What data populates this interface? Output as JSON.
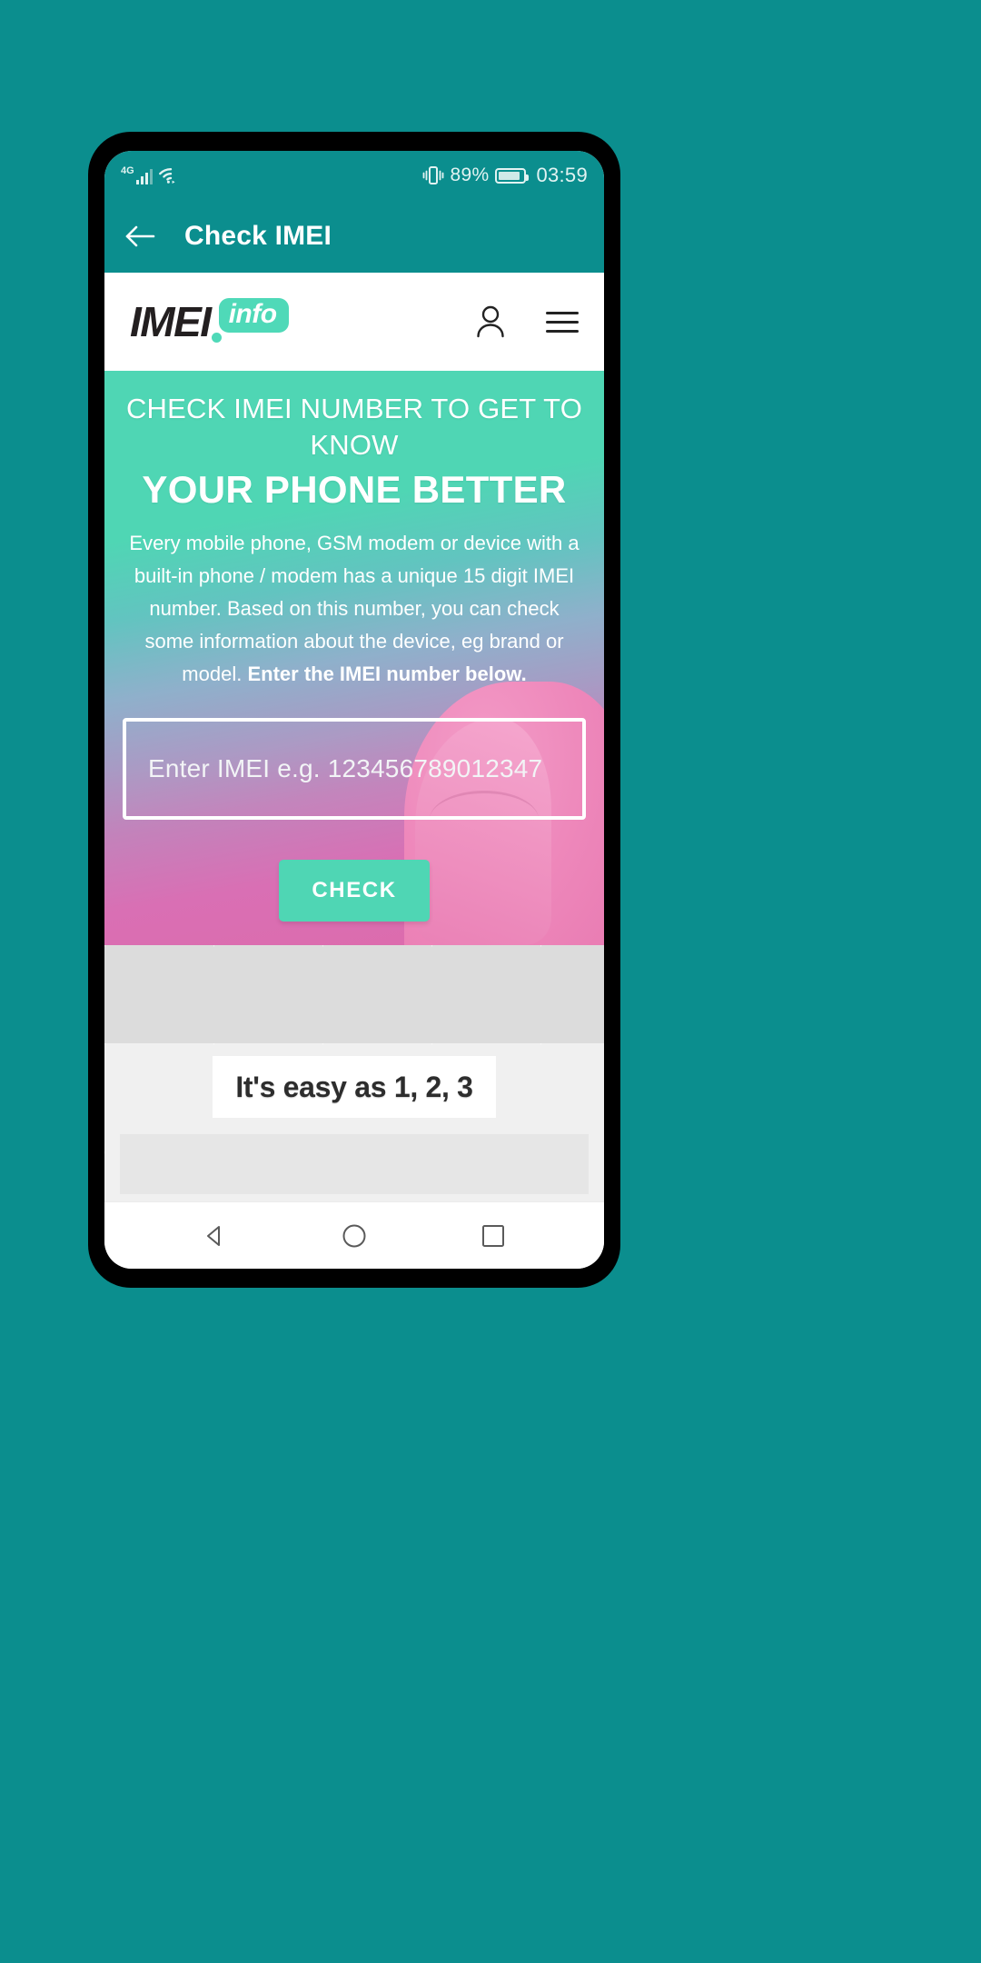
{
  "theme": {
    "teal": "#0b8e8e",
    "mint": "#4fd6b4",
    "pink": "#dd6bab",
    "white": "#ffffff",
    "page_background": "#0b8e8e"
  },
  "status_bar": {
    "network_label": "4G",
    "signal_icon": "signal-bars-icon",
    "wifi_icon": "wifi-icon",
    "vibrate_icon": "vibrate-icon",
    "battery_percent": "89%",
    "battery_icon": "battery-icon",
    "clock": "03:59"
  },
  "app_bar": {
    "back_icon": "arrow-left-icon",
    "title": "Check IMEI"
  },
  "web_header": {
    "logo": {
      "primary": "IMEI",
      "badge": "info"
    },
    "account_icon": "user-icon",
    "menu_icon": "hamburger-menu-icon"
  },
  "hero": {
    "heading_line1": "CHECK IMEI NUMBER TO GET TO KNOW",
    "heading_line2": "YOUR PHONE BETTER",
    "paragraph": "Every mobile phone, GSM modem or device with a built-in phone / modem has a unique 15 digit IMEI number. Based on this number, you can check some information about the device, eg brand or model.",
    "paragraph_bold": "Enter the IMEI number below.",
    "input": {
      "placeholder": "Enter IMEI e.g. 123456789012347",
      "value": ""
    },
    "check_button": "CHECK"
  },
  "easy_section": {
    "title": "It's easy as 1, 2, 3"
  },
  "nav_bar": {
    "back_icon": "nav-back-triangle-icon",
    "home_icon": "nav-home-circle-icon",
    "recents_icon": "nav-recents-square-icon"
  }
}
